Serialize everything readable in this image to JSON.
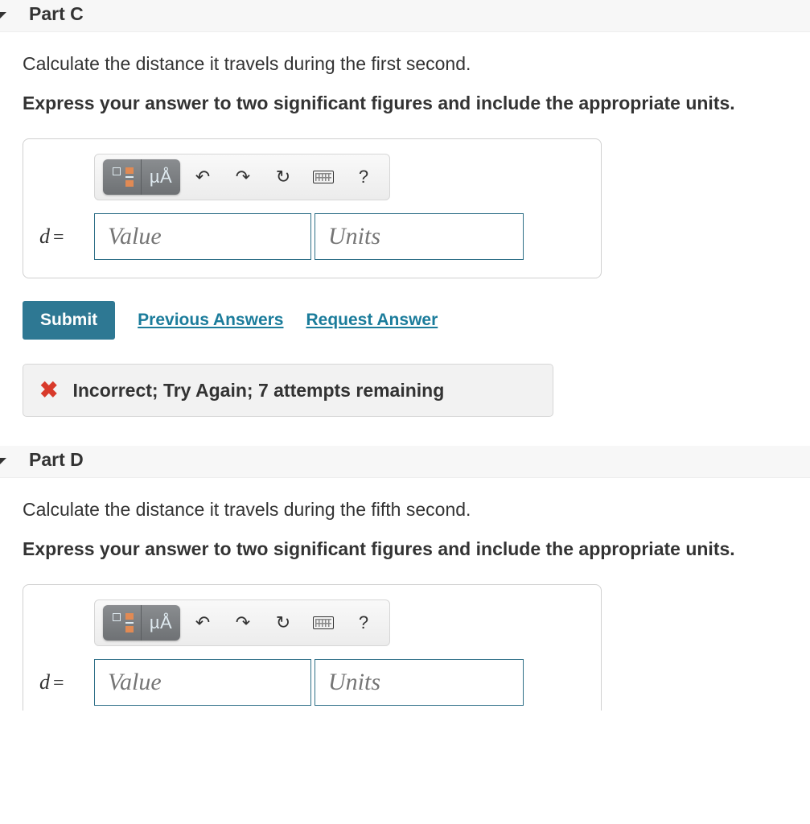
{
  "parts": [
    {
      "key": "c",
      "title": "Part C",
      "prompt": "Calculate the distance it travels during the first second.",
      "instruction": "Express your answer to two significant figures and include the appropriate units.",
      "variable": "d",
      "equals": "=",
      "value_placeholder": "Value",
      "units_placeholder": "Units",
      "toolbar": {
        "special_label": "µÅ",
        "help_label": "?"
      },
      "actions": {
        "submit": "Submit",
        "previous_answers": "Previous Answers",
        "request_answer": "Request Answer"
      },
      "feedback": {
        "status": "incorrect",
        "text": "Incorrect; Try Again; 7 attempts remaining"
      }
    },
    {
      "key": "d",
      "title": "Part D",
      "prompt": "Calculate the distance it travels during the fifth second.",
      "instruction": "Express your answer to two significant figures and include the appropriate units.",
      "variable": "d",
      "equals": "=",
      "value_placeholder": "Value",
      "units_placeholder": "Units",
      "toolbar": {
        "special_label": "µÅ",
        "help_label": "?"
      }
    }
  ]
}
